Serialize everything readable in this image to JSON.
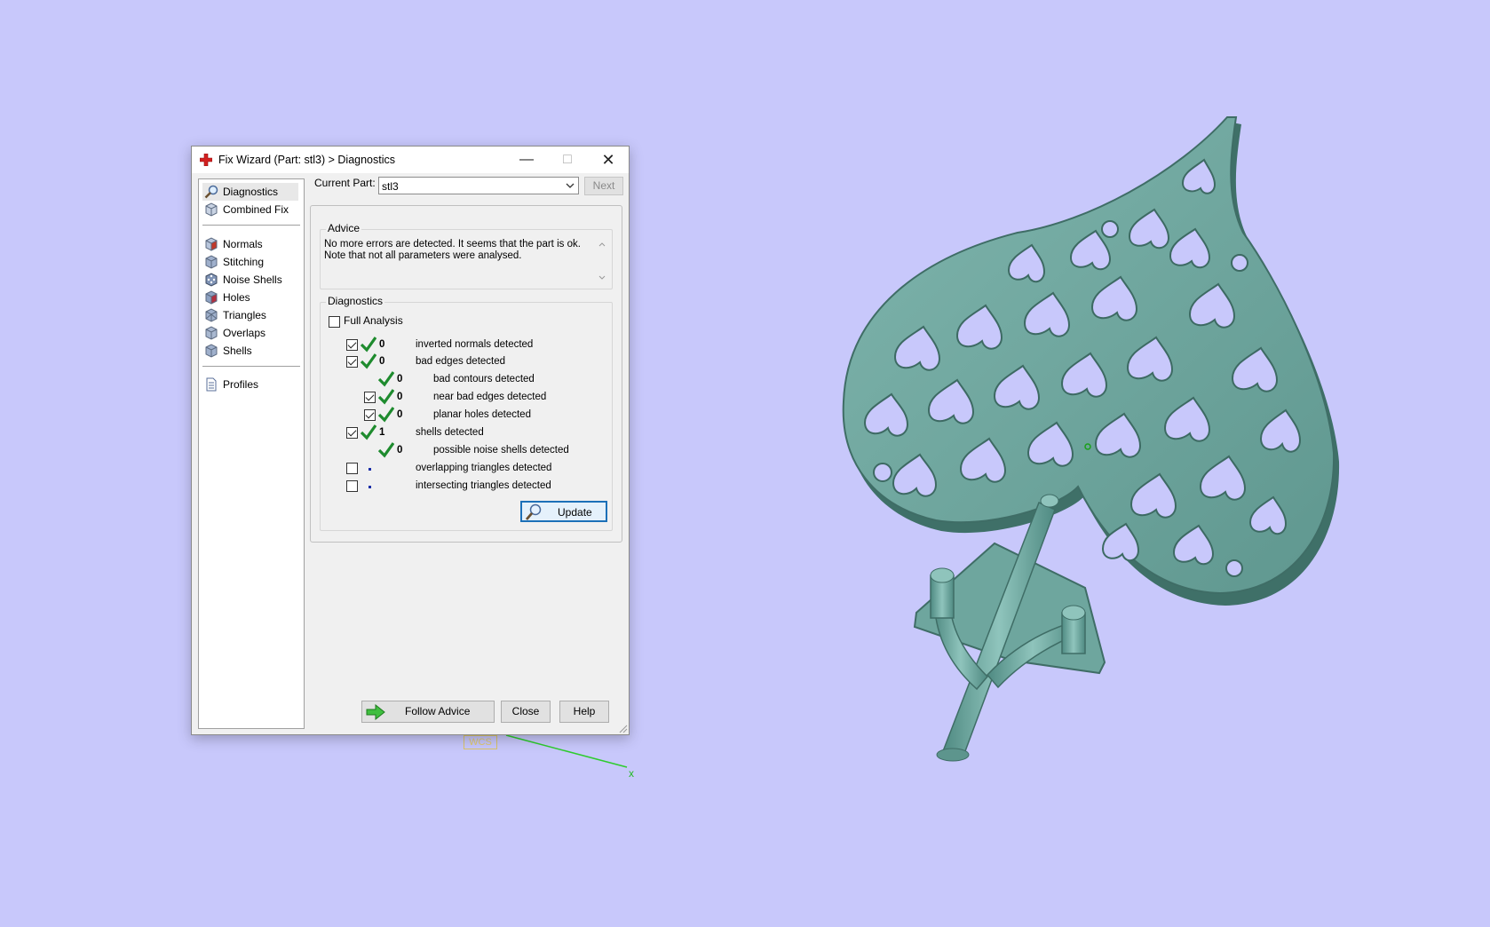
{
  "window": {
    "title": "Fix Wizard (Part: stl3) > Diagnostics",
    "title_icon": "red-cross-icon"
  },
  "sidebar": {
    "items": [
      {
        "label": "Diagnostics",
        "icon": "magnifier-icon",
        "selected": true
      },
      {
        "label": "Combined Fix",
        "icon": "cube-icon"
      },
      {
        "label": "Normals",
        "icon": "cube-red-face-icon"
      },
      {
        "label": "Stitching",
        "icon": "cube-icon"
      },
      {
        "label": "Noise Shells",
        "icon": "dice-icon"
      },
      {
        "label": "Holes",
        "icon": "cube-hole-icon"
      },
      {
        "label": "Triangles",
        "icon": "cube-icon"
      },
      {
        "label": "Overlaps",
        "icon": "cube-icon"
      },
      {
        "label": "Shells",
        "icon": "cube-icon"
      },
      {
        "label": "Profiles",
        "icon": "document-icon"
      }
    ]
  },
  "top": {
    "current_part_label": "Current Part:",
    "current_part_value": "stl3",
    "next_label": "Next"
  },
  "advice": {
    "legend": "Advice",
    "text": "No more errors are detected. It seems that the part is ok.\nNote that not all parameters were analysed."
  },
  "diagnostics": {
    "legend": "Diagnostics",
    "full_analysis_label": "Full Analysis",
    "rows": [
      {
        "checked": true,
        "status": "ok",
        "count": "0",
        "label": "inverted normals detected"
      },
      {
        "checked": true,
        "status": "ok",
        "count": "0",
        "label": "bad edges detected"
      },
      {
        "checked": null,
        "status": "ok",
        "count": "0",
        "label": "bad contours detected",
        "indent": true
      },
      {
        "checked": true,
        "status": "ok",
        "count": "0",
        "label": "near bad edges detected",
        "indent": true
      },
      {
        "checked": true,
        "status": "ok",
        "count": "0",
        "label": "planar holes detected",
        "indent": true
      },
      {
        "checked": true,
        "status": "ok",
        "count": "1",
        "label": "shells detected"
      },
      {
        "checked": null,
        "status": "ok",
        "count": "0",
        "label": "possible noise shells detected",
        "indent": true
      },
      {
        "checked": false,
        "status": "not-run",
        "count": "",
        "label": "overlapping triangles detected"
      },
      {
        "checked": false,
        "status": "not-run",
        "count": "",
        "label": "intersecting triangles detected"
      }
    ],
    "update_label": "Update"
  },
  "buttons": {
    "follow_advice": "Follow Advice",
    "close": "Close",
    "help": "Help"
  },
  "viewport": {
    "wcs_label": "WCS",
    "axis_x_label": "x",
    "background": "#c8c8fb",
    "model_color": "#6ea69e"
  }
}
